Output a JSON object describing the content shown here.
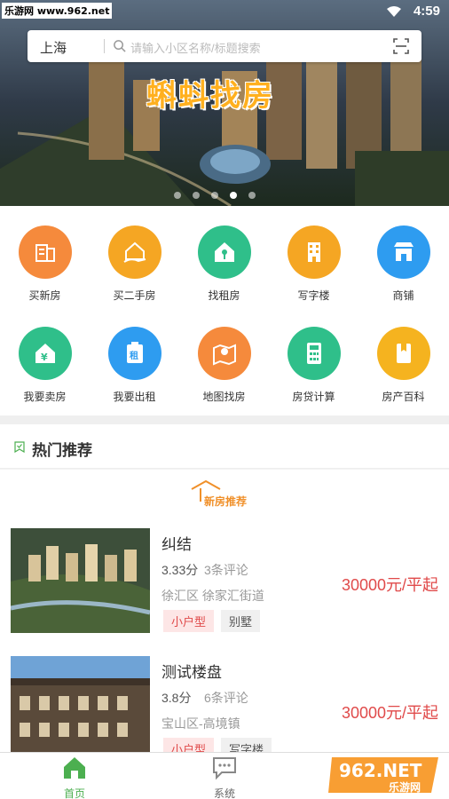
{
  "status_bar": {
    "watermark_site": "乐游网 www.962.net",
    "time": "4:59"
  },
  "search": {
    "city": "上海",
    "placeholder": "请输入小区名称/标题搜索"
  },
  "banner": {
    "title": "蝌蚪找房",
    "slide_count": 5,
    "active_slide": 3
  },
  "categories": [
    {
      "label": "买新房",
      "icon": "building-icon",
      "color": "#f58a3c"
    },
    {
      "label": "买二手房",
      "icon": "house-hand-icon",
      "color": "#f5a623"
    },
    {
      "label": "找租房",
      "icon": "house-key-icon",
      "color": "#2fbf8a"
    },
    {
      "label": "写字楼",
      "icon": "office-building-icon",
      "color": "#f5a623"
    },
    {
      "label": "商铺",
      "icon": "shop-icon",
      "color": "#2e9cf0"
    },
    {
      "label": "我要卖房",
      "icon": "house-yen-icon",
      "color": "#2fbf8a"
    },
    {
      "label": "我要出租",
      "icon": "rent-clipboard-icon",
      "color": "#2e9cf0"
    },
    {
      "label": "地图找房",
      "icon": "map-pin-icon",
      "color": "#f58a3c"
    },
    {
      "label": "房贷计算",
      "icon": "calculator-icon",
      "color": "#2fbf8a"
    },
    {
      "label": "房产百科",
      "icon": "book-icon",
      "color": "#f5b31f"
    }
  ],
  "hot_section": {
    "title": "热门推荐",
    "tab_label": "新房推荐"
  },
  "listings": [
    {
      "name": "纠结",
      "score": "3.33分",
      "reviews": "3条评论",
      "address": "徐汇区 徐家汇街道",
      "tags": [
        "小户型",
        "别墅"
      ],
      "price": "30000元/平起"
    },
    {
      "name": "测试楼盘",
      "score": "3.8分",
      "reviews": "6条评论",
      "address": "宝山区-高境镇",
      "tags": [
        "小户型",
        "写字楼"
      ],
      "price": "30000元/平起"
    }
  ],
  "bottom_nav": [
    {
      "label": "首页",
      "icon": "home-icon",
      "active": true
    },
    {
      "label": "系统",
      "icon": "message-icon",
      "active": false
    }
  ],
  "watermark": {
    "text": "962.NET",
    "subtext": "乐游网"
  },
  "colors": {
    "accent_green": "#4caf50",
    "price_red": "#e04a4a",
    "banner_orange": "#ffb01f"
  }
}
